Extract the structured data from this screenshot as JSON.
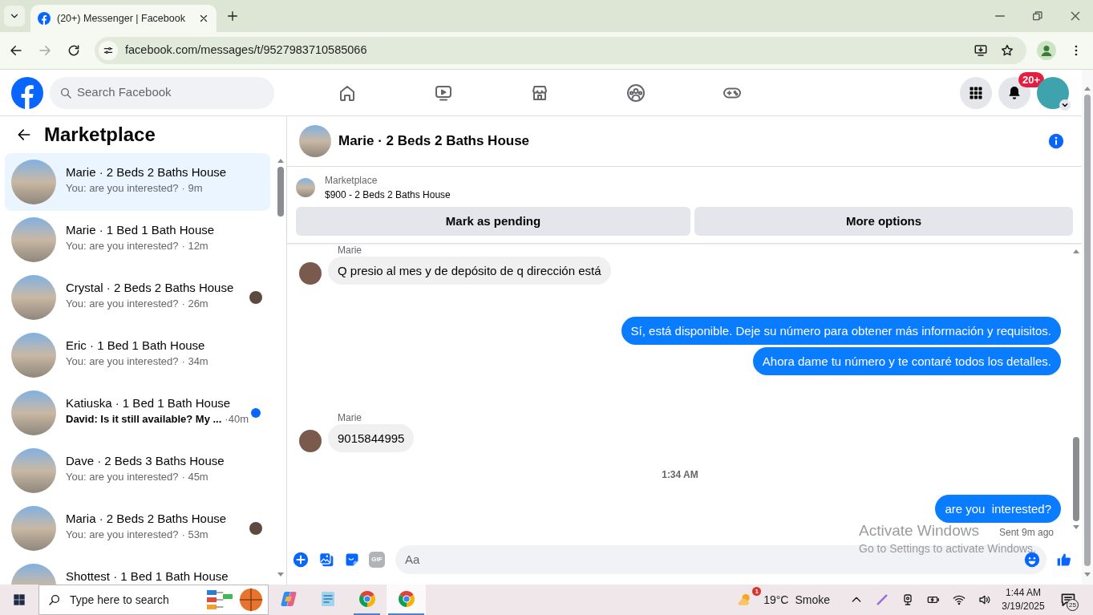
{
  "browser": {
    "tab_title": "(20+) Messenger | Facebook",
    "url": "facebook.com/messages/t/9527983710585066"
  },
  "topbar": {
    "search_placeholder": "Search Facebook",
    "nav": [
      {
        "kind": "home"
      },
      {
        "kind": "video"
      },
      {
        "kind": "marketplace"
      },
      {
        "kind": "groups"
      },
      {
        "kind": "gaming"
      }
    ],
    "notification_badge": "20+"
  },
  "sidebar": {
    "title": "Marketplace",
    "conversations": [
      {
        "title": "Marie · 2 Beds 2 Baths House",
        "preview": "You: are you interested?",
        "time": "· 9m",
        "selected": true,
        "unread": false,
        "seen": false
      },
      {
        "title": "Marie · 1 Bed 1 Bath House",
        "preview": "You: are you interested?",
        "time": "· 12m",
        "selected": false,
        "unread": false,
        "seen": false
      },
      {
        "title": "Crystal · 2 Beds 2 Baths House",
        "preview": "You: are you interested?",
        "time": "· 26m",
        "selected": false,
        "unread": false,
        "seen": true
      },
      {
        "title": "Eric · 1 Bed 1 Bath House",
        "preview": "You: are you interested?",
        "time": "· 34m",
        "selected": false,
        "unread": false,
        "seen": false
      },
      {
        "title": "Katiuska · 1 Bed 1 Bath House",
        "preview": "David: Is it still available? My ...",
        "time": "·40m",
        "selected": false,
        "unread": true,
        "seen": false
      },
      {
        "title": "Dave · 2 Beds 3 Baths House",
        "preview": "You: are you interested?",
        "time": "· 45m",
        "selected": false,
        "unread": false,
        "seen": false
      },
      {
        "title": "Maria · 2 Beds 2 Baths House",
        "preview": "You: are you interested?",
        "time": "· 53m",
        "selected": false,
        "unread": false,
        "seen": true
      },
      {
        "title": "Shottest · 1 Bed 1 Bath House",
        "selected": false,
        "unread": false,
        "seen": false
      }
    ]
  },
  "chat": {
    "title": "Marie · 2 Beds 2 Baths House",
    "listing": {
      "source": "Marketplace",
      "name": "$900 - 2 Beds 2 Baths House"
    },
    "actions": [
      "Mark as pending",
      "More options"
    ],
    "messages": [
      {
        "kind": "incoming",
        "sender": "Marie",
        "text": "Q presio al mes y de depósito de q dirección está"
      },
      {
        "kind": "outgoing",
        "text": "Sí, está disponible. Deje su número para obtener más información y requisitos."
      },
      {
        "kind": "outgoing",
        "text": "Ahora dame tu número y te contaré todos los detalles."
      },
      {
        "kind": "incoming",
        "sender": "Marie",
        "text": "9015844995"
      },
      {
        "kind": "timestamp",
        "text": "1:34 AM"
      },
      {
        "kind": "outgoing",
        "text": "are you  interested?"
      }
    ],
    "delivery_status": "Sent 9m ago",
    "composer": {
      "gif_label": "GIF",
      "placeholder": "Aa"
    }
  },
  "activation_notice": {
    "title": "Activate Windows",
    "subtitle": "Go to Settings to activate Windows."
  },
  "taskbar": {
    "search_placeholder": "Type here to search",
    "apps": [
      {
        "kind": "assistant",
        "running": false,
        "selected": false
      },
      {
        "kind": "notes",
        "running": false,
        "selected": false
      },
      {
        "kind": "browser",
        "running": true,
        "selected": false
      },
      {
        "kind": "browser",
        "running": true,
        "selected": true
      }
    ],
    "weather": {
      "badge": "1",
      "temperature": "19°C",
      "condition": "Smoke"
    },
    "clock": {
      "time": "1:44 AM",
      "date": "3/19/2025"
    },
    "notification_count": "25"
  }
}
